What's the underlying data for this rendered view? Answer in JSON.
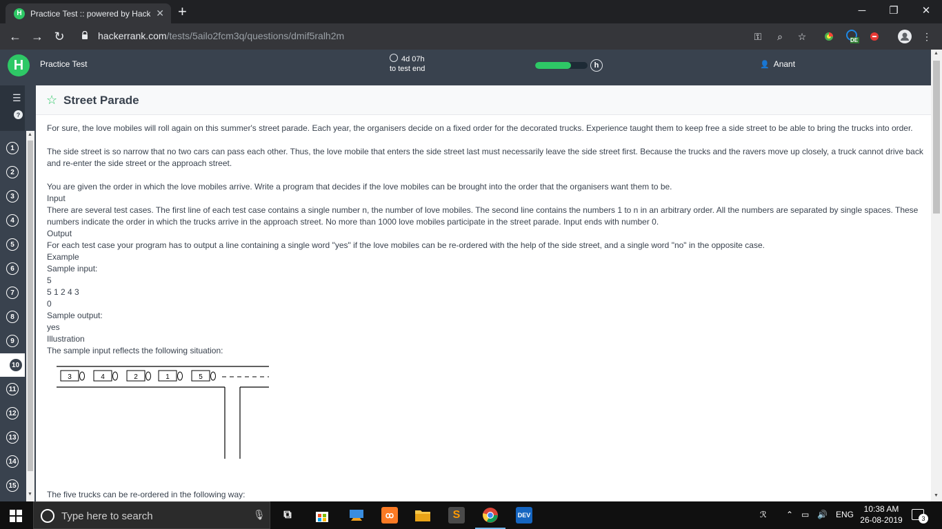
{
  "browser": {
    "tab_title": "Practice Test :: powered by Hacke",
    "tab_favicon": "H",
    "url_host": "hackerrank.com",
    "url_path": "/tests/5ailo2fcm3q/questions/dmif5ralh2m",
    "profile_badge": "DE"
  },
  "header": {
    "logo_letter": "H",
    "test_title": "Practice Test",
    "timer_value": "4d 07h",
    "timer_label": "to test end",
    "progress_fraction": 0.68,
    "mini_logo": "h",
    "user_name": "Anant"
  },
  "sidebar": {
    "help_label": "?",
    "questions": [
      "1",
      "2",
      "3",
      "4",
      "5",
      "6",
      "7",
      "8",
      "9",
      "10",
      "11",
      "12",
      "13",
      "14",
      "15"
    ],
    "active_question": "10"
  },
  "question": {
    "title": "Street Parade",
    "p1": "For sure, the love mobiles will roll again on this summer's street parade. Each year, the organisers decide on a fixed order for the decorated trucks. Experience taught them to keep free a side street to be able to bring the trucks into order.",
    "p2": "The side street is so narrow that no two cars can pass each other. Thus, the love mobile that enters the side street last must necessarily leave the side street first. Because the trucks and the ravers move up closely, a truck cannot drive back and re-enter the side street or the approach street.",
    "p3": "You are given the order in which the love mobiles arrive. Write a program that decides if the love mobiles can be brought into the order that the organisers want them to be.",
    "input_heading": "Input",
    "input_text": "There are several test cases. The first line of each test case contains a single number n, the number of love mobiles. The second line contains the numbers 1 to n in an arbitrary order. All the numbers are separated by single spaces. These numbers indicate the order in which the trucks arrive in the approach street. No more than 1000 love mobiles participate in the street parade. Input ends with number 0.",
    "output_heading": "Output",
    "output_text": "For each test case your program has to output a line containing a single word \"yes\" if the love mobiles can be re-ordered with the help of the side street, and a single word \"no\" in the opposite case.",
    "example_heading": "Example",
    "sample_input_label": "Sample input:",
    "sample_input_lines": [
      "5",
      "5 1 2 4 3",
      "0"
    ],
    "sample_output_label": "Sample output:",
    "sample_output_lines": [
      "yes"
    ],
    "illustration_heading": "Illustration",
    "illustration_caption": "The sample input reflects the following situation:",
    "diagram_trucks": [
      "3",
      "4",
      "2",
      "1",
      "5"
    ],
    "reorder_caption": "The five trucks can be re-ordered in the following way:"
  },
  "taskbar": {
    "search_placeholder": "Type here to search",
    "language": "ENG",
    "time": "10:38 AM",
    "date": "26-08-2019",
    "notification_count": "3",
    "dev_label": "DEV"
  }
}
